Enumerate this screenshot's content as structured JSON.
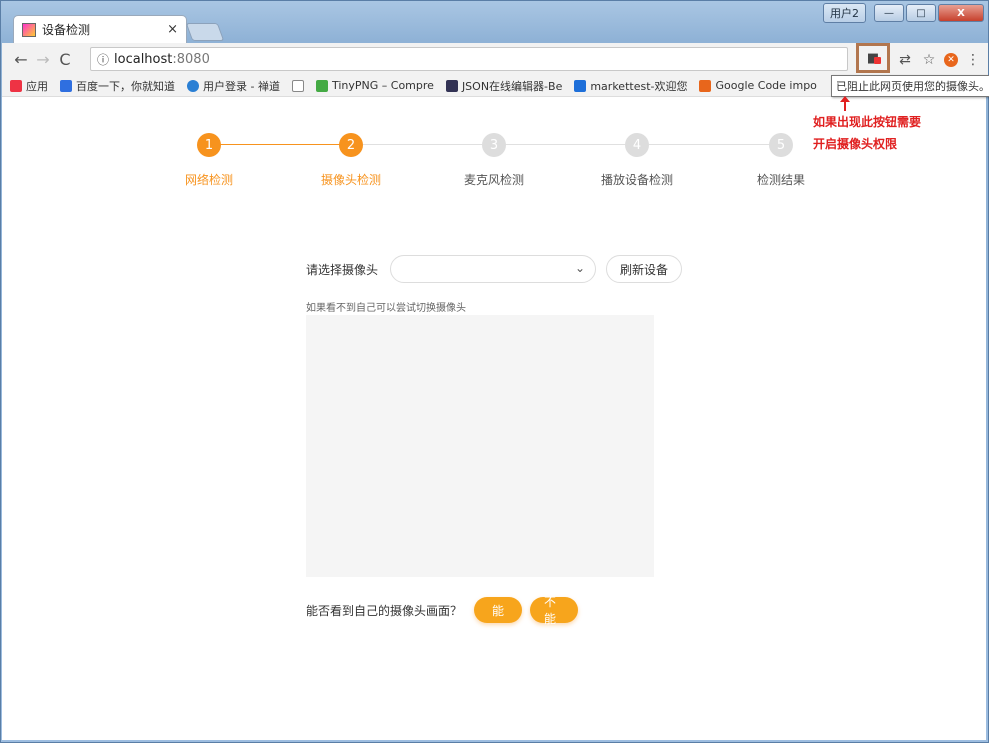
{
  "window": {
    "user_label": "用户2",
    "minimize": "—",
    "maximize": "□",
    "close": "X"
  },
  "tab": {
    "title": "设备检测",
    "close": "×"
  },
  "toolbar": {
    "url_host": "localhost",
    "url_port": ":8080",
    "info_icon": "ⓘ"
  },
  "bookmarks": [
    {
      "label": "应用",
      "color": "#e34"
    },
    {
      "label": "百度一下，你就知道",
      "color": "#2f6fe0"
    },
    {
      "label": "用户登录 - 禅道",
      "color": "#2a7fd4"
    },
    {
      "label": "",
      "color": "#888"
    },
    {
      "label": "TinyPNG – Compre",
      "color": "#4a4"
    },
    {
      "label": "JSON在线编辑器-Be",
      "color": "#335"
    },
    {
      "label": "markettest-欢迎您",
      "color": "#1e6fd9"
    },
    {
      "label": "Google Code impo",
      "color": "#e8661c"
    }
  ],
  "tooltip": "已阻止此网页使用您的摄像头。",
  "annotation": {
    "line1": "如果出现此按钮需要",
    "line2": "开启摄像头权限"
  },
  "steps": [
    {
      "num": "1",
      "label": "网络检测",
      "active": true
    },
    {
      "num": "2",
      "label": "摄像头检测",
      "active": true
    },
    {
      "num": "3",
      "label": "麦克风检测",
      "active": false
    },
    {
      "num": "4",
      "label": "播放设备检测",
      "active": false
    },
    {
      "num": "5",
      "label": "检测结果",
      "active": false
    }
  ],
  "camera": {
    "select_label": "请选择摄像头",
    "select_value": "",
    "refresh_button": "刷新设备",
    "hint": "如果看不到自己可以尝试切换摄像头",
    "question": "能否看到自己的摄像头画面？",
    "yes": "能",
    "no": "不能"
  },
  "colors": {
    "accent": "#f7931e",
    "annotation": "#e02020"
  }
}
